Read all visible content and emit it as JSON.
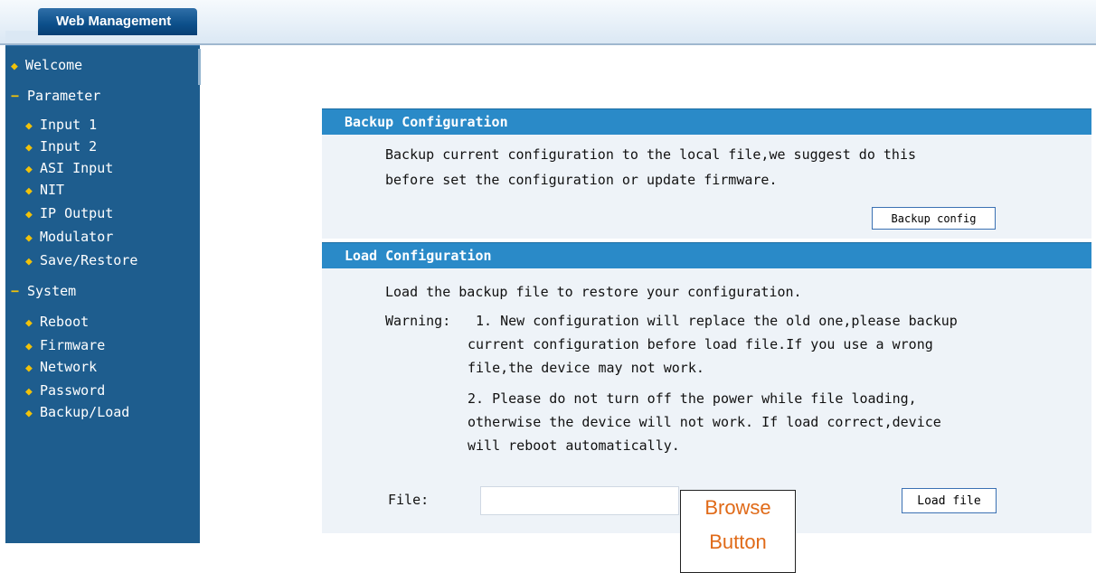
{
  "header": {
    "title": "Web Management"
  },
  "sidebar": {
    "items": [
      {
        "type": "item",
        "label": "Welcome"
      },
      {
        "type": "group",
        "label": "Parameter"
      },
      {
        "type": "sub",
        "label": "Input 1"
      },
      {
        "type": "sub",
        "label": "Input 2"
      },
      {
        "type": "sub",
        "label": "ASI Input"
      },
      {
        "type": "sub",
        "label": "NIT"
      },
      {
        "type": "sub",
        "label": "IP Output"
      },
      {
        "type": "sub",
        "label": "Modulator"
      },
      {
        "type": "sub",
        "label": "Save/Restore"
      },
      {
        "type": "group",
        "label": "System"
      },
      {
        "type": "sub",
        "label": "Reboot"
      },
      {
        "type": "sub",
        "label": "Firmware"
      },
      {
        "type": "sub",
        "label": "Network"
      },
      {
        "type": "sub",
        "label": "Password"
      },
      {
        "type": "sub",
        "label": "Backup/Load"
      }
    ]
  },
  "backup": {
    "title": "Backup Configuration",
    "desc_line1": "Backup current configuration to the local file,we suggest do this",
    "desc_line2": "before set the configuration or update firmware.",
    "button": "Backup config"
  },
  "load": {
    "title": "Load Configuration",
    "intro": "Load the backup file to restore your configuration.",
    "warning_label": "Warning:",
    "w1_line1": "1. New configuration will replace the old one,please backup",
    "w1_line2": "current configuration before load file.If you use a wrong",
    "w1_line3": "file,the device may not work.",
    "w2_line1": "2. Please do not turn off the power while file loading,",
    "w2_line2": "otherwise the device will not work. If load correct,device",
    "w2_line3": "will reboot automatically.",
    "file_label": "File:",
    "file_value": "",
    "button": "Load file"
  },
  "annotation": {
    "line1": "Browse",
    "line2": "Button"
  },
  "colors": {
    "sidebar_bg": "#1e5d8e",
    "panel_header": "#2a8ac8",
    "panel_bg": "#eef3f8",
    "bullet": "#f1c20a",
    "callout_text": "#e06a18"
  }
}
